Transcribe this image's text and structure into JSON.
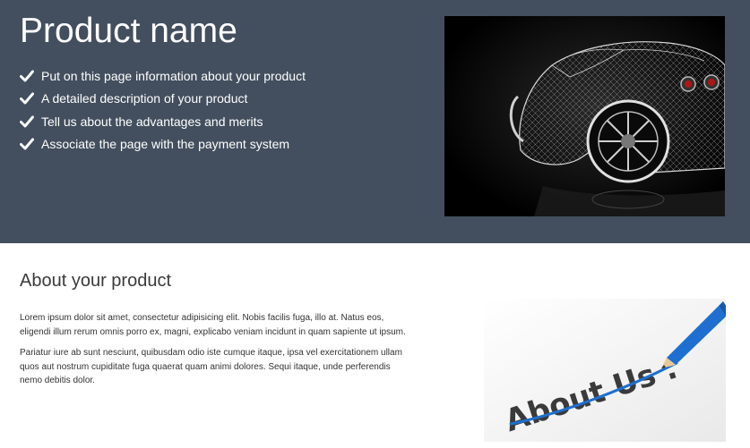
{
  "hero": {
    "title": "Product name",
    "features": [
      "Put on this page information about your product",
      "A detailed description of your product",
      "Tell us about the advantages and merits",
      "Associate the page with the payment system"
    ],
    "check_icon": "check-icon",
    "image_subject": "car-wireframe-image"
  },
  "about": {
    "title": "About your product",
    "paragraphs": [
      "Lorem ipsum dolor sit amet, consectetur adipisicing elit. Nobis facilis fuga, illo at. Natus eos, eligendi illum rerum omnis porro ex, magni, explicabo veniam incidunt in quam sapiente ut ipsum.",
      "Pariatur iure ab sunt nesciunt, quibusdam odio iste cumque itaque, ipsa vel exercitationem ullam quos aut nostrum cupiditate fuga quaerat quam animi dolores. Sequi itaque, unde perferendis nemo debitis dolor."
    ],
    "image_text": "About Us ."
  },
  "colors": {
    "hero_bg": "#434f5e",
    "hero_text": "#ffffff",
    "pencil_blue": "#1e6fd0"
  }
}
